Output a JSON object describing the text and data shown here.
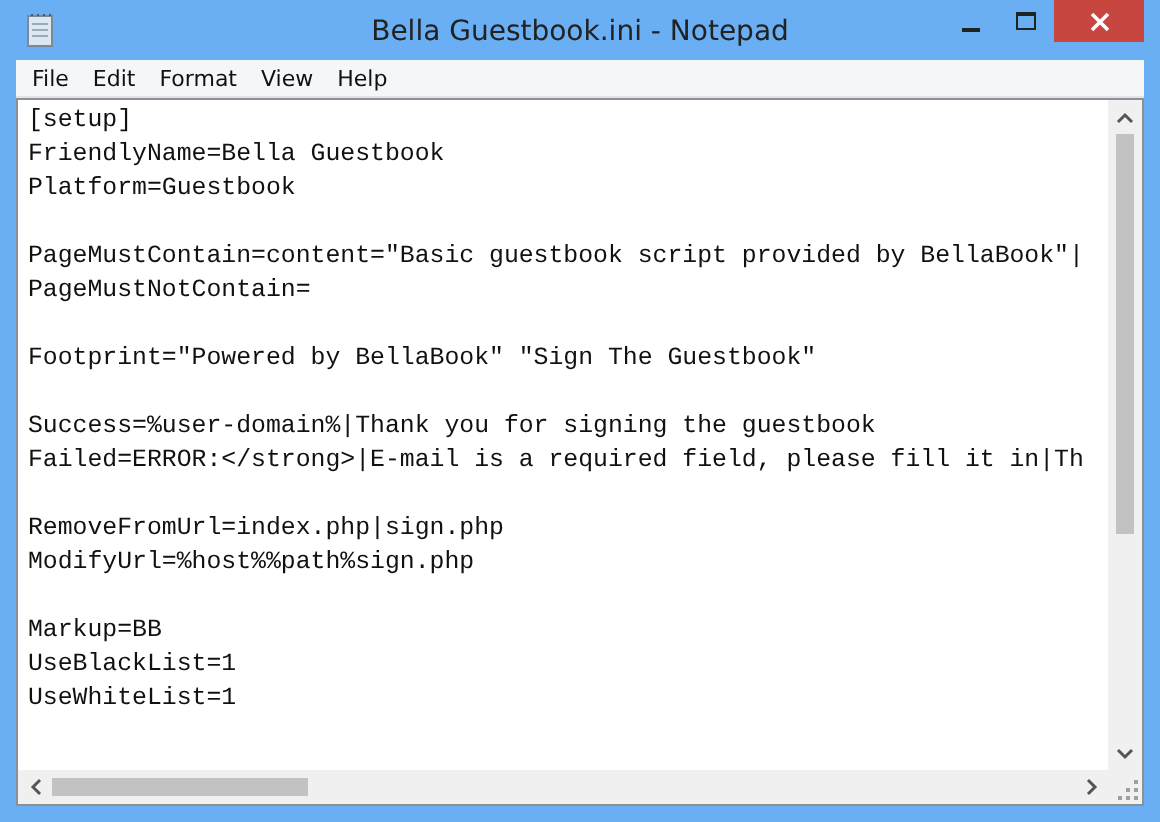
{
  "window": {
    "title": "Bella Guestbook.ini - Notepad"
  },
  "menu": [
    "File",
    "Edit",
    "Format",
    "View",
    "Help"
  ],
  "document": {
    "paragraphs": [
      [
        "[setup]",
        "FriendlyName=Bella Guestbook",
        "Platform=Guestbook"
      ],
      [
        "PageMustContain=content=\"Basic guestbook script provided by BellaBook\"|",
        "PageMustNotContain="
      ],
      [
        "Footprint=\"Powered by BellaBook\" \"Sign The Guestbook\""
      ],
      [
        "Success=%user-domain%|Thank you for signing the guestbook",
        "Failed=ERROR:</strong>|E-mail is a required field, please fill it in|Th"
      ],
      [
        "RemoveFromUrl=index.php|sign.php",
        "ModifyUrl=%host%%path%sign.php"
      ],
      [
        "Markup=BB",
        "UseBlackList=1",
        "UseWhiteList=1"
      ]
    ]
  }
}
